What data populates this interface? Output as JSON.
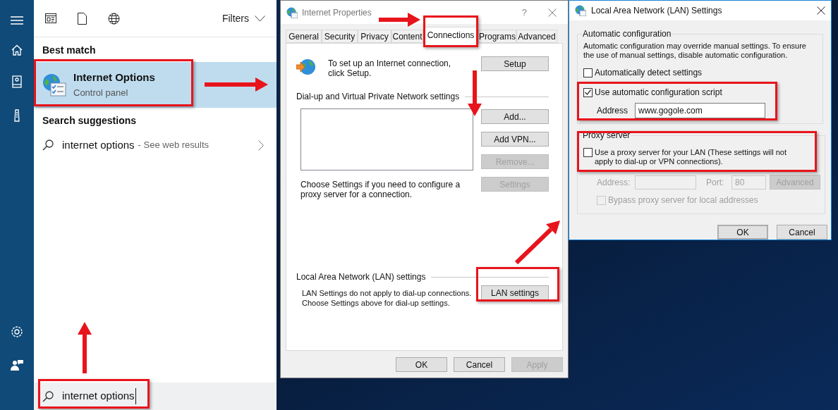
{
  "search_panel": {
    "filters": "Filters",
    "best_match_heading": "Best match",
    "best_match": {
      "title": "Internet Options",
      "subtitle": "Control panel",
      "selected": true
    },
    "suggestions_heading": "Search suggestions",
    "suggestions": [
      {
        "query": "internet options",
        "hint": "- See web results"
      }
    ],
    "search_box": {
      "value": "internet options"
    }
  },
  "internet_properties": {
    "title": "Internet Properties",
    "help": "?",
    "tabs": [
      {
        "label": "General",
        "selected": false
      },
      {
        "label": "Security",
        "selected": false
      },
      {
        "label": "Privacy",
        "selected": false
      },
      {
        "label": "Content",
        "selected": false
      },
      {
        "label": "Connections",
        "selected": true
      },
      {
        "label": "Programs",
        "selected": false
      },
      {
        "label": "Advanced",
        "selected": false
      }
    ],
    "setup_text": "To set up an Internet connection, click Setup.",
    "setup_button": "Setup",
    "dialup_heading": "Dial-up and Virtual Private Network settings",
    "dialup_buttons": [
      {
        "label": "Add...",
        "disabled": false
      },
      {
        "label": "Add VPN...",
        "disabled": false
      },
      {
        "label": "Remove...",
        "disabled": true
      },
      {
        "label": "Settings",
        "disabled": true
      }
    ],
    "proxy_text": "Choose Settings if you need to configure a proxy server for a connection.",
    "lan_heading": "Local Area Network (LAN) settings",
    "lan_text": [
      "LAN Settings do not apply to dial-up connections.",
      "Choose Settings above for dial-up settings."
    ],
    "lan_button": "LAN settings",
    "footer_buttons": [
      {
        "label": "OK",
        "disabled": false
      },
      {
        "label": "Cancel",
        "disabled": false
      },
      {
        "label": "Apply",
        "disabled": true
      }
    ]
  },
  "lan_dialog": {
    "title": "Local Area Network (LAN) Settings",
    "auto_heading": "Automatic configuration",
    "auto_text": "Automatic configuration may override manual settings.  To ensure the use of manual settings, disable automatic configuration.",
    "auto_options": [
      {
        "label": "Automatically detect settings",
        "checked": false
      },
      {
        "label": "Use automatic configuration script",
        "checked": true
      }
    ],
    "address_label": "Address",
    "address_value": "www.gogole.com",
    "proxy_heading": "Proxy server",
    "proxy_option": {
      "label": "Use a proxy server for your LAN (These settings will not apply to dial-up or VPN connections).",
      "checked": false
    },
    "proxy_address_label": "Address:",
    "port_label": "Port:",
    "port_value": "80",
    "advanced_button": {
      "label": "Advanced",
      "disabled": true
    },
    "bypass_option": {
      "label": "Bypass proxy server for local addresses",
      "checked": false,
      "disabled": true
    },
    "buttons": [
      {
        "label": "OK",
        "default": true
      },
      {
        "label": "Cancel",
        "default": false
      }
    ]
  }
}
